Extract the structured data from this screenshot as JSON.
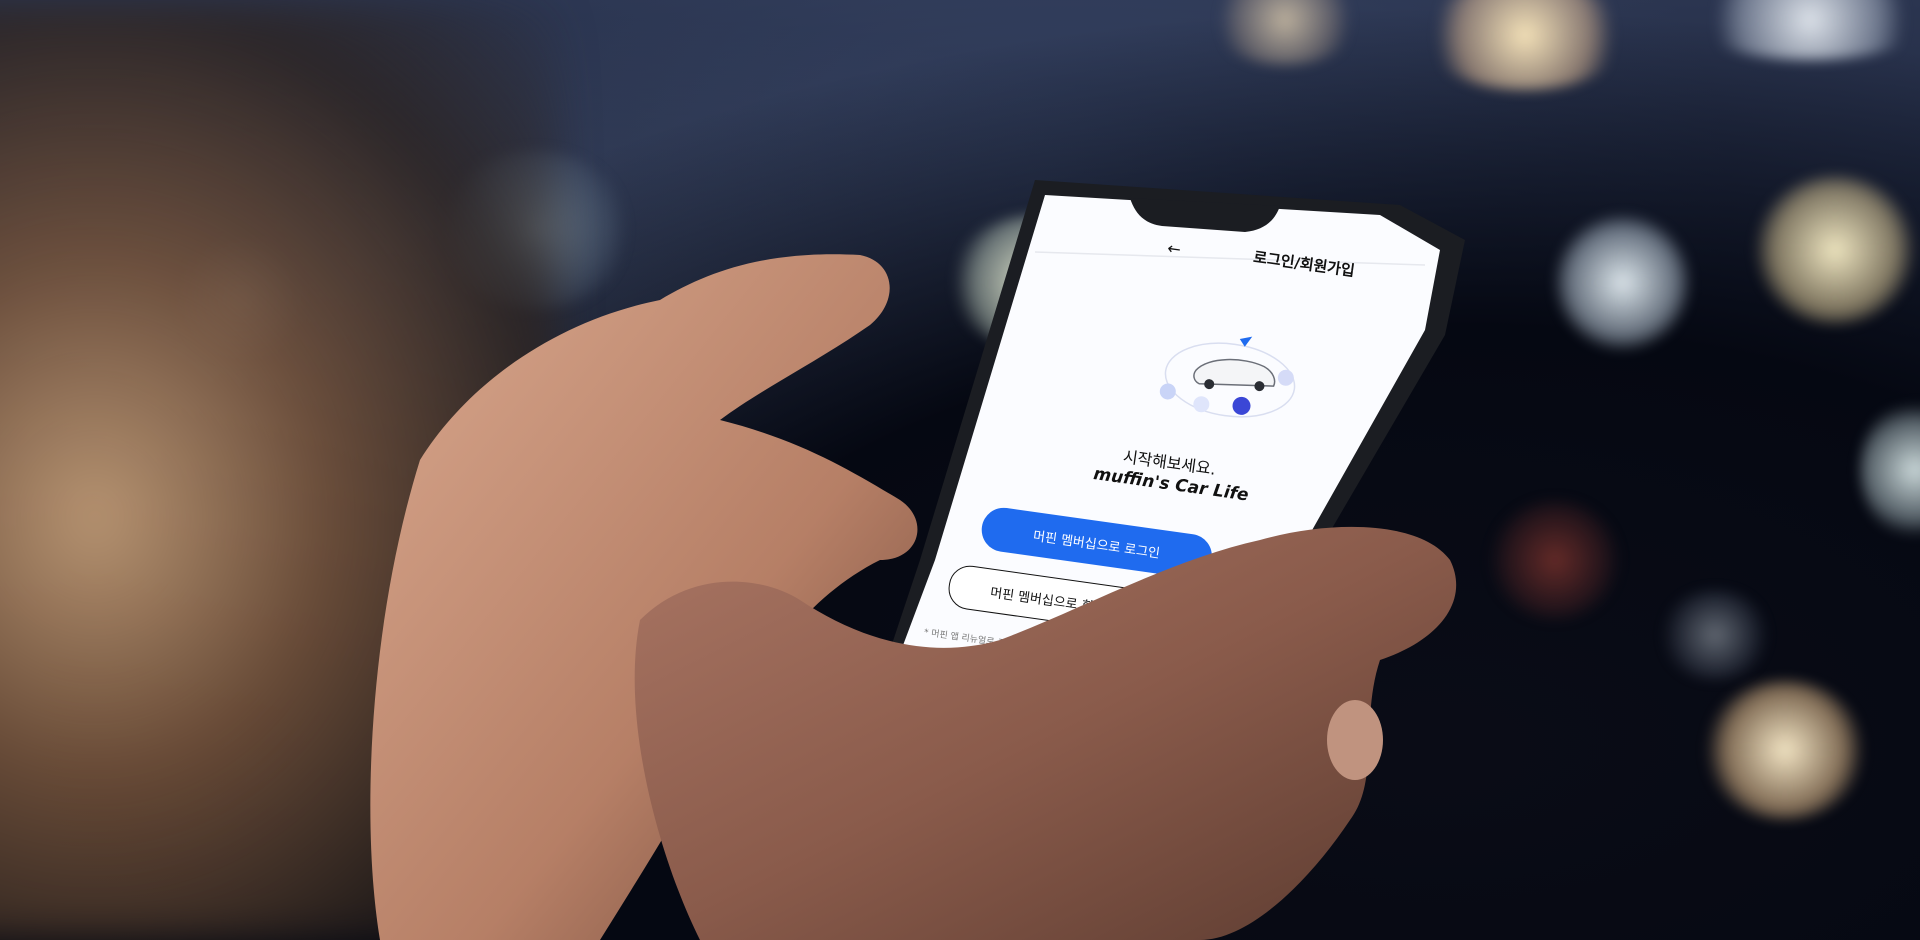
{
  "screen": {
    "header": {
      "back_icon": "arrow-left-icon",
      "title": "로그인/회원가입"
    },
    "hero": {
      "illustration": "car-with-icons-illustration",
      "headline": "시작해보세요.",
      "brand": "muffin's Car Life"
    },
    "buttons": {
      "login_label": "머핀 멤버십으로 로그인",
      "signup_label": "머핀 멤버십으로 회원가"
    },
    "notice": "* 머핀 앱 리뉴얼로 구버전 회원은 머핀",
    "colors": {
      "primary_blue": "#1f6bef",
      "screen_bg": "#ffffff",
      "phone_frame": "#1b1d22"
    }
  }
}
